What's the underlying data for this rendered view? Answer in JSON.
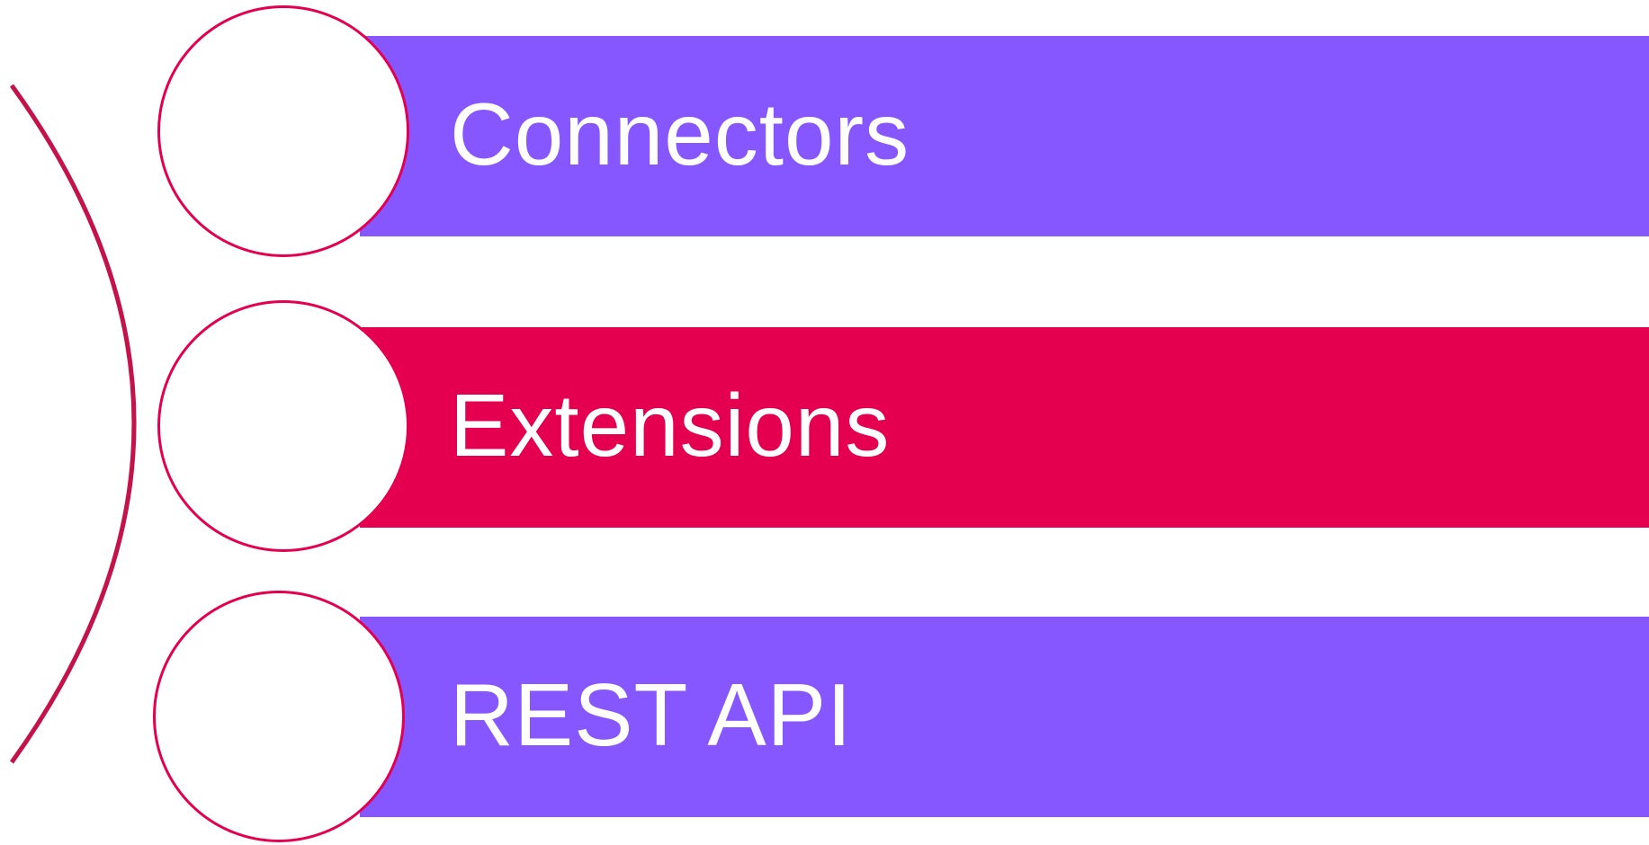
{
  "colors": {
    "purple": "#8657ff",
    "magenta": "#e4004f",
    "arc": "#c3134a",
    "circle_fill": "#ffffff",
    "text": "#ffffff"
  },
  "items": [
    {
      "label": "Connectors",
      "color": "#8657ff"
    },
    {
      "label": "Extensions",
      "color": "#e4004f"
    },
    {
      "label": "REST API",
      "color": "#8657ff"
    }
  ]
}
